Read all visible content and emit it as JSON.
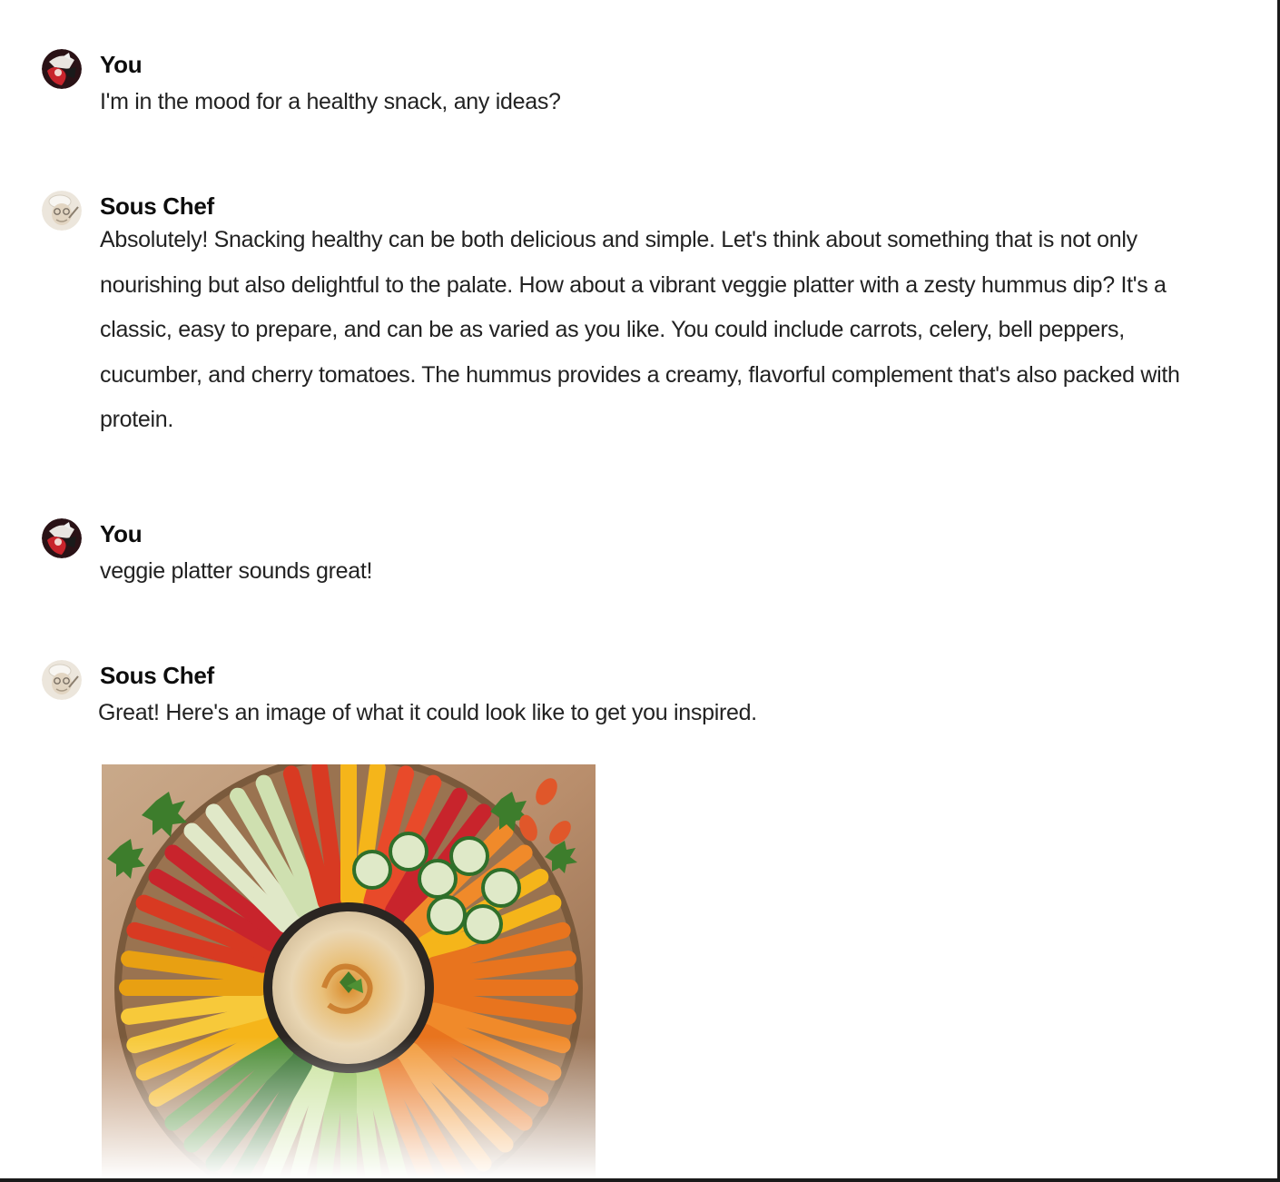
{
  "conversation": {
    "messages": [
      {
        "role": "user",
        "author": "You",
        "avatar_icon": "user-avatar-icon",
        "text": "I'm in the mood for a healthy snack, any ideas?"
      },
      {
        "role": "assistant",
        "author": "Sous Chef",
        "avatar_icon": "chef-avatar-icon",
        "text": "Absolutely! Snacking healthy can be both delicious and simple. Let's think about something that is not only nourishing but also delightful to the palate. How about a vibrant veggie platter with a zesty hummus dip? It's a classic, easy to prepare, and can be as varied as you like. You could include carrots, celery, bell peppers, cucumber, and cherry tomatoes. The hummus provides a creamy, flavorful complement that's also packed with protein."
      },
      {
        "role": "user",
        "author": "You",
        "avatar_icon": "user-avatar-icon",
        "text": "veggie platter sounds great!"
      },
      {
        "role": "assistant",
        "author": "Sous Chef",
        "avatar_icon": "chef-avatar-icon",
        "text": "Great! Here's an image of what it could look like to get you inspired.",
        "image_icon": "veggie-platter-image"
      }
    ]
  },
  "colors": {
    "text": "#0d0d0d",
    "body_text": "#222222",
    "background": "#ffffff"
  }
}
